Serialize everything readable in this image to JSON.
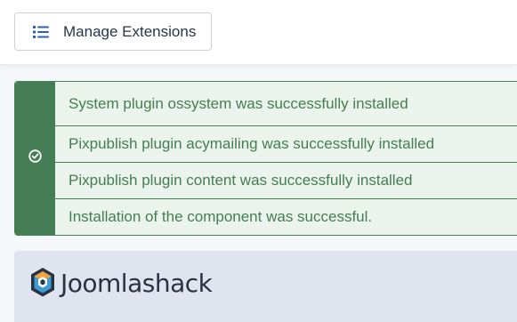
{
  "toolbar": {
    "manage_button_label": "Manage Extensions",
    "manage_button_icon": "list-icon"
  },
  "alert": {
    "status": "success",
    "icon": "check-circle-icon",
    "color": "#457d54",
    "background": "#ebf4ec",
    "messages": [
      "System plugin ossystem was successfully installed",
      "Pixpublish plugin acymailing was successfully installed",
      "Pixpublish plugin content was successfully installed",
      "Installation of the component was successful."
    ]
  },
  "brand": {
    "name": "Joomlashack",
    "logo_icon": "joomlashack-logo-icon"
  }
}
